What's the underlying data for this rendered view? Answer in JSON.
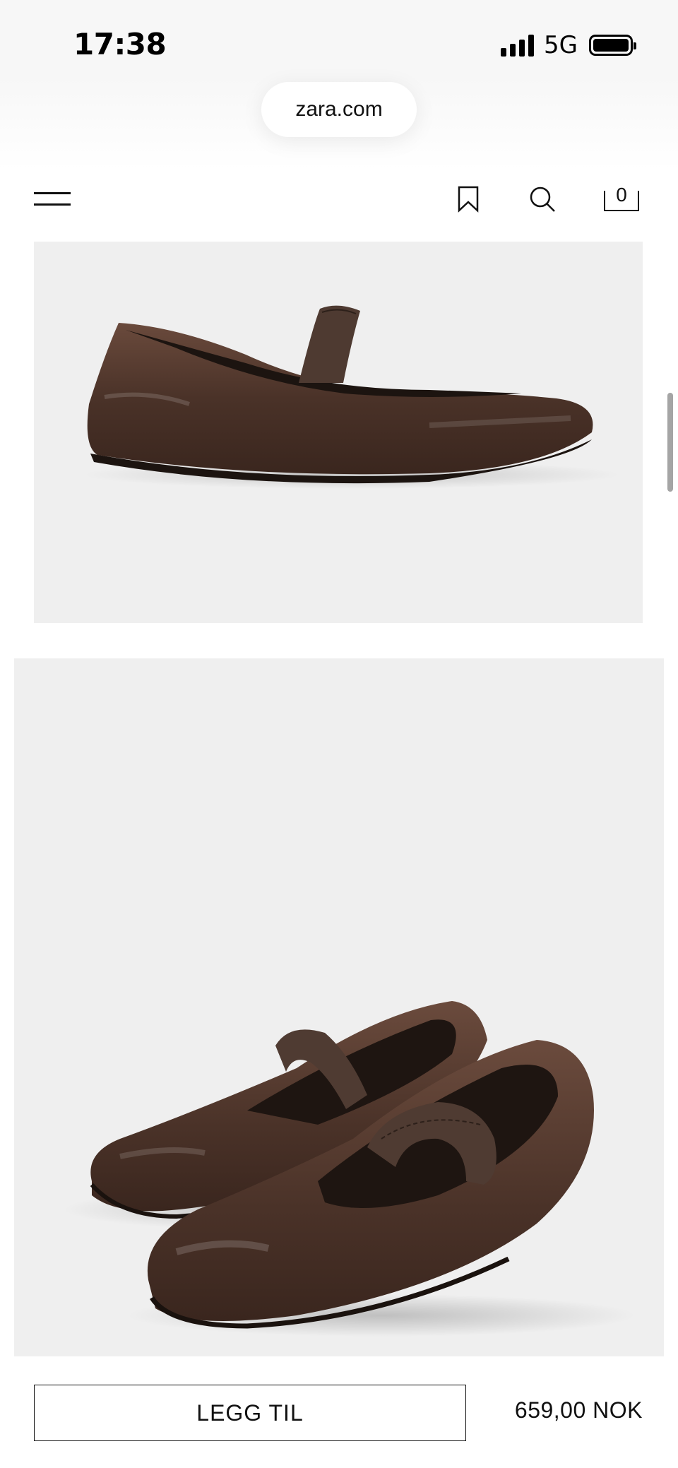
{
  "status_bar": {
    "time": "17:38",
    "network": "5G",
    "signal_icon": "signal-bars-icon",
    "battery_icon": "battery-full-icon"
  },
  "browser": {
    "url": "zara.com"
  },
  "header": {
    "menu_icon": "hamburger-menu-icon",
    "bookmark_icon": "bookmark-icon",
    "search_icon": "search-icon",
    "bag_icon": "shopping-bag-icon",
    "bag_count": "0"
  },
  "product": {
    "images": [
      {
        "description_icon": "shoe-side-view-image"
      },
      {
        "description_icon": "shoe-pair-image"
      }
    ],
    "add_button_label": "LEGG TIL",
    "price": "659,00 NOK"
  },
  "colors": {
    "shoe_brown": "#4a3228",
    "image_background": "#efefef",
    "text": "#111111"
  }
}
